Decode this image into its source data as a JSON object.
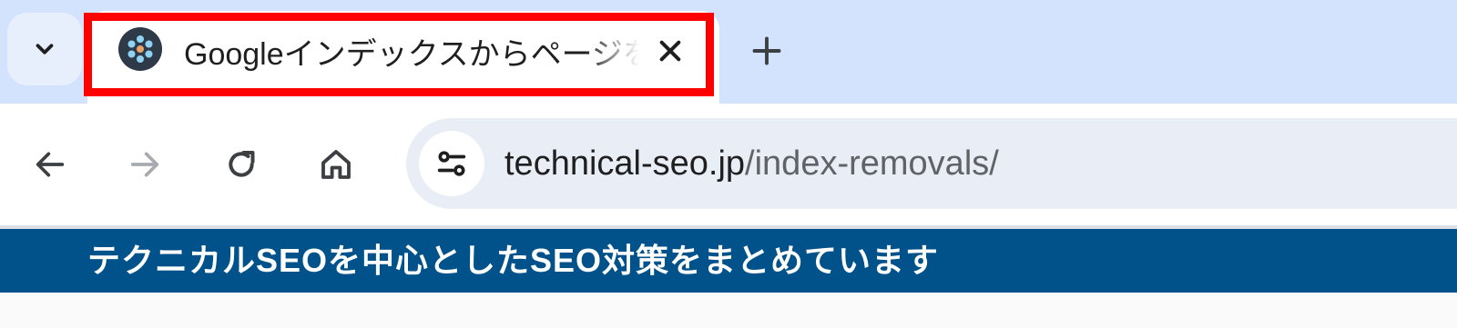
{
  "tab": {
    "title": "Googleインデックスからページを削除",
    "favicon": "site-favicon-icon",
    "highlight_color": "#ff0000"
  },
  "tabstrip": {
    "search_icon": "chevron-down-icon",
    "new_tab_icon": "plus-icon"
  },
  "toolbar": {
    "back_icon": "arrow-left-icon",
    "forward_icon": "arrow-right-icon",
    "reload_icon": "reload-icon",
    "home_icon": "home-icon",
    "site_info_icon": "tune-icon"
  },
  "address_bar": {
    "host": "technical-seo.jp",
    "path": "/index-removals/"
  },
  "page": {
    "banner_text": "テクニカルSEOを中心としたSEO対策をまとめています",
    "banner_color": "#01528a"
  },
  "colors": {
    "tabstrip_bg": "#d3e3fd",
    "omnibox_bg": "#e9eef6"
  }
}
